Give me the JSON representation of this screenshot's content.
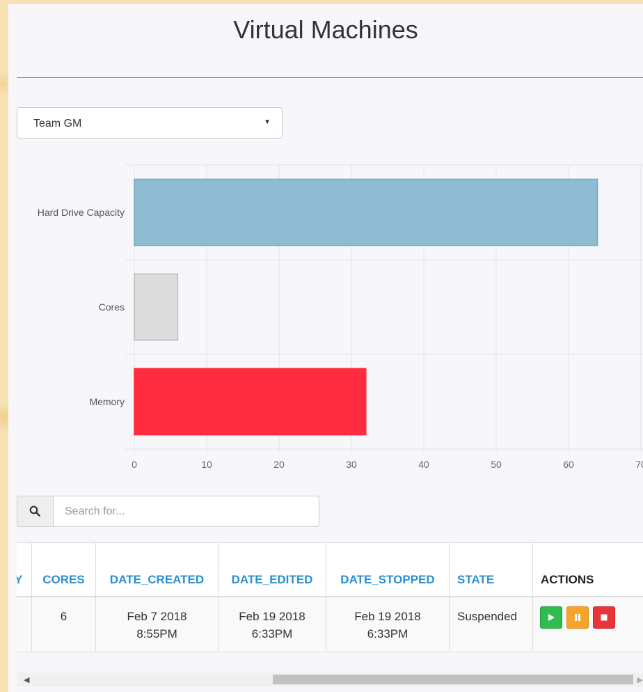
{
  "page": {
    "title": "Virtual Machines"
  },
  "team_select": {
    "value": "Team GM"
  },
  "chart_data": {
    "type": "bar",
    "orientation": "horizontal",
    "categories": [
      "Hard Drive Capacity",
      "Cores",
      "Memory"
    ],
    "values": [
      64,
      6,
      32
    ],
    "colors": [
      "#8fbcd2",
      "#dcdcdc",
      "#ff2b3f"
    ],
    "xlim": [
      0,
      70
    ],
    "xticks": [
      "0",
      "10",
      "20",
      "30",
      "40",
      "50",
      "60",
      "70"
    ],
    "grid": true
  },
  "search": {
    "placeholder": "Search for..."
  },
  "table": {
    "columns": [
      "Y",
      "CORES",
      "DATE_CREATED",
      "DATE_EDITED",
      "DATE_STOPPED",
      "STATE",
      "ACTIONS"
    ],
    "rows": [
      {
        "cores": "6",
        "date_created": [
          "Feb 7 2018",
          "8:55PM"
        ],
        "date_edited": [
          "Feb 19 2018",
          "6:33PM"
        ],
        "date_stopped": [
          "Feb 19 2018",
          "6:33PM"
        ],
        "state": "Suspended"
      }
    ]
  },
  "icons": {
    "search": "search-icon",
    "play": "play-icon",
    "pause": "pause-icon",
    "stop": "stop-icon"
  }
}
